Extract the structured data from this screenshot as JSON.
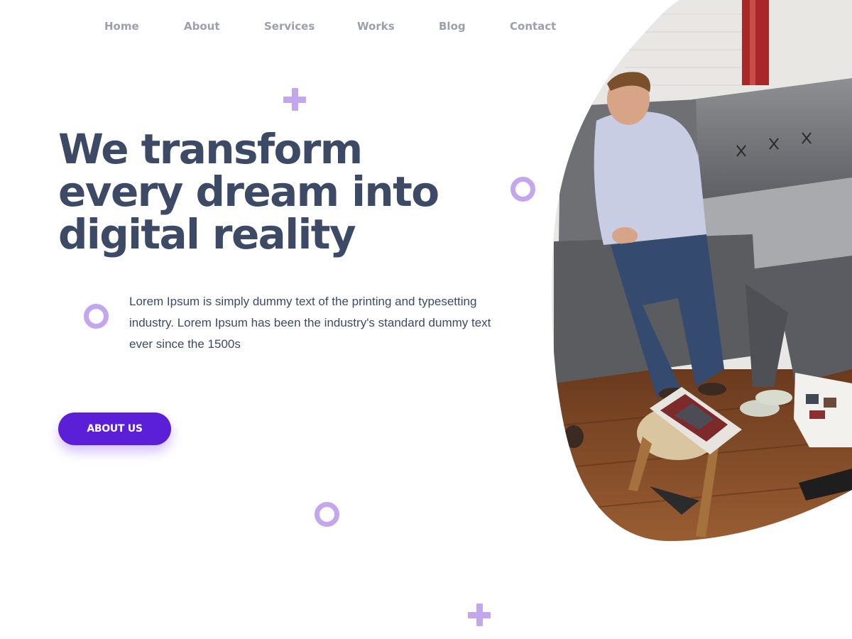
{
  "nav": {
    "items": [
      {
        "label": "Home"
      },
      {
        "label": "About"
      },
      {
        "label": "Services"
      },
      {
        "label": "Works"
      },
      {
        "label": "Blog"
      },
      {
        "label": "Contact"
      }
    ]
  },
  "hero": {
    "title_lines": [
      "We transform",
      "every dream into",
      "digital reality"
    ],
    "description": "Lorem Ipsum is simply dummy text of the printing and typesetting industry. Lorem Ipsum has been the industry's standard dummy text ever since the 1500s",
    "button_label": "ABOUT US"
  },
  "colors": {
    "heading": "#3d4a66",
    "nav_text": "#9b9fae",
    "button_bg": "#5b1fd8",
    "decoration": "#c3a6ee"
  },
  "icons": {
    "decorations": [
      "plus-icon",
      "ring-icon"
    ]
  },
  "photo": {
    "alt": "People sitting on a grey sofa reading magazines"
  }
}
